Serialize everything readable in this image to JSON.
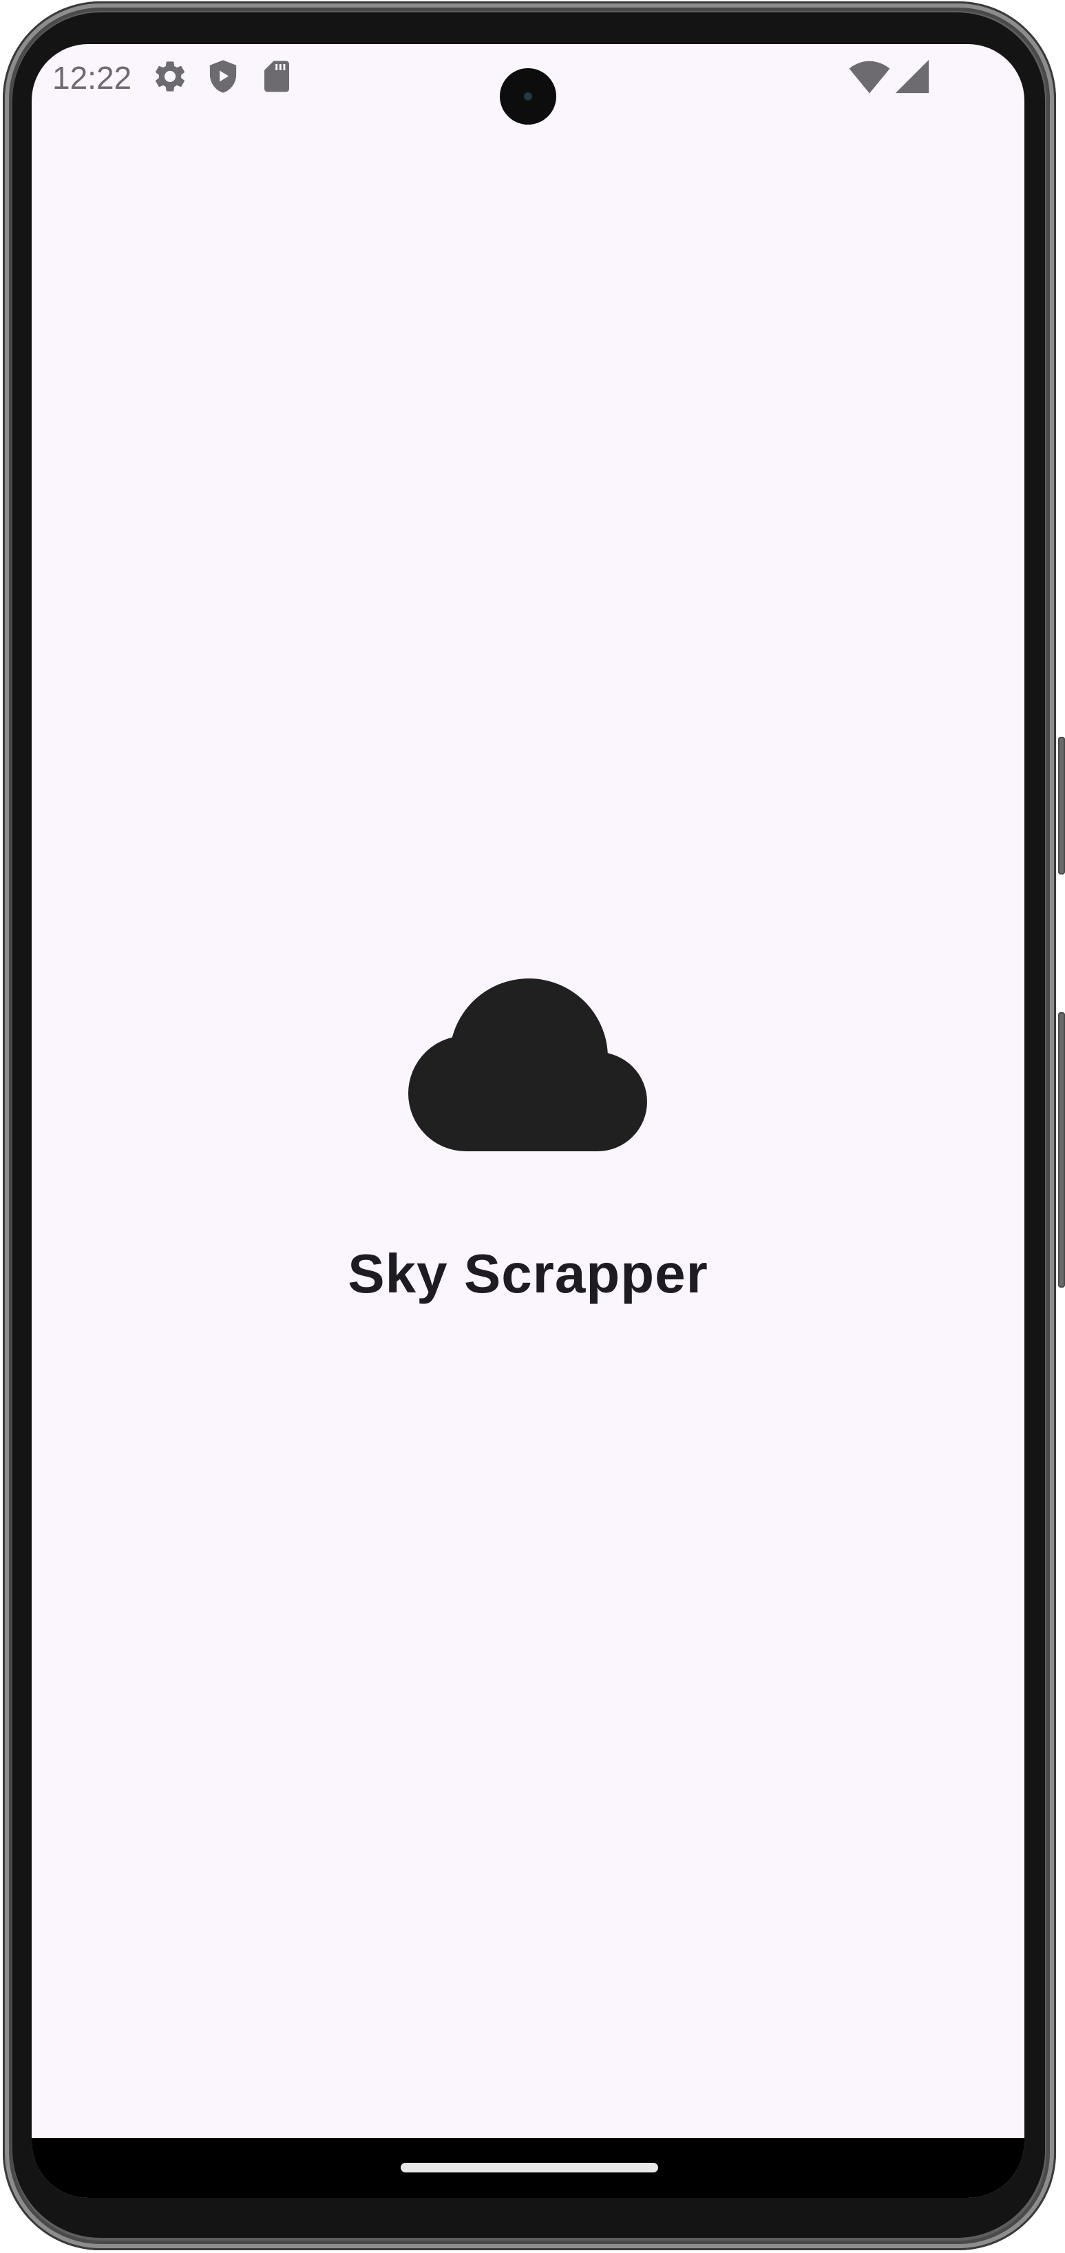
{
  "status_bar": {
    "time": "12:22",
    "left_icons": [
      "gear-icon",
      "shield-play-icon",
      "sd-card-icon"
    ],
    "right_icons": [
      "wifi-icon",
      "cellular-signal-icon"
    ],
    "icon_color": "#6d6a70"
  },
  "splash": {
    "app_icon": "cloud-icon",
    "app_name": "Sky Scrapper",
    "background_color": "#fbf5fd",
    "icon_color": "#202020",
    "title_color": "#1f1b22"
  },
  "navigation": {
    "type": "gesture-handle"
  }
}
